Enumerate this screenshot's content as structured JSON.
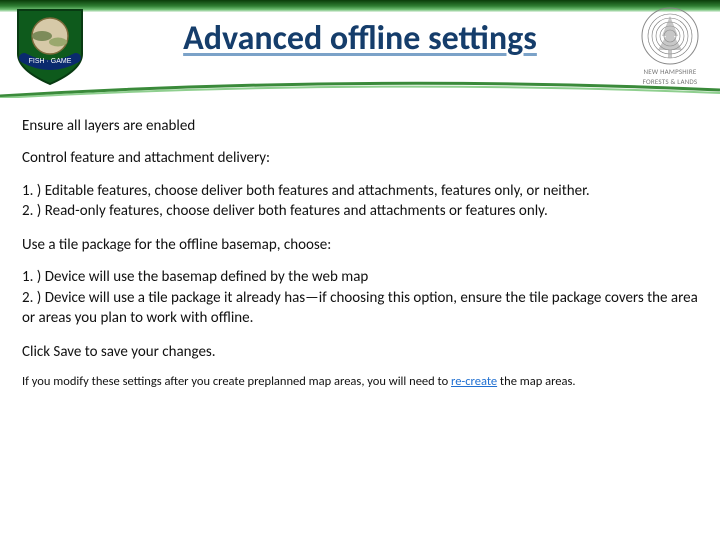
{
  "header": {
    "title": "Advanced offline settings",
    "logo_left_banner": "FISH · GAME",
    "logo_right_line1": "NEW HAMPSHIRE",
    "logo_right_line2": "FORESTS & LANDS"
  },
  "body": {
    "p1": "Ensure all layers are enabled",
    "p2": "Control feature and attachment delivery:",
    "p3a": "1. ) Editable features, choose deliver both features and attachments, features only, or neither.",
    "p3b": "2. ) Read-only features, choose deliver both features and attachments or features only.",
    "p4": "Use a tile package for the offline basemap, choose:",
    "p5a": "1. ) Device will use the basemap defined by the web map",
    "p5b": "2. ) Device will use a tile package it already has—if choosing this option, ensure the tile package covers the area or areas you plan to work with offline.",
    "p6": "Click Save to save your changes.",
    "foot_pre": "If you modify these settings after you create preplanned map areas, you will need to ",
    "foot_link": "re-create",
    "foot_post": " the map areas."
  }
}
